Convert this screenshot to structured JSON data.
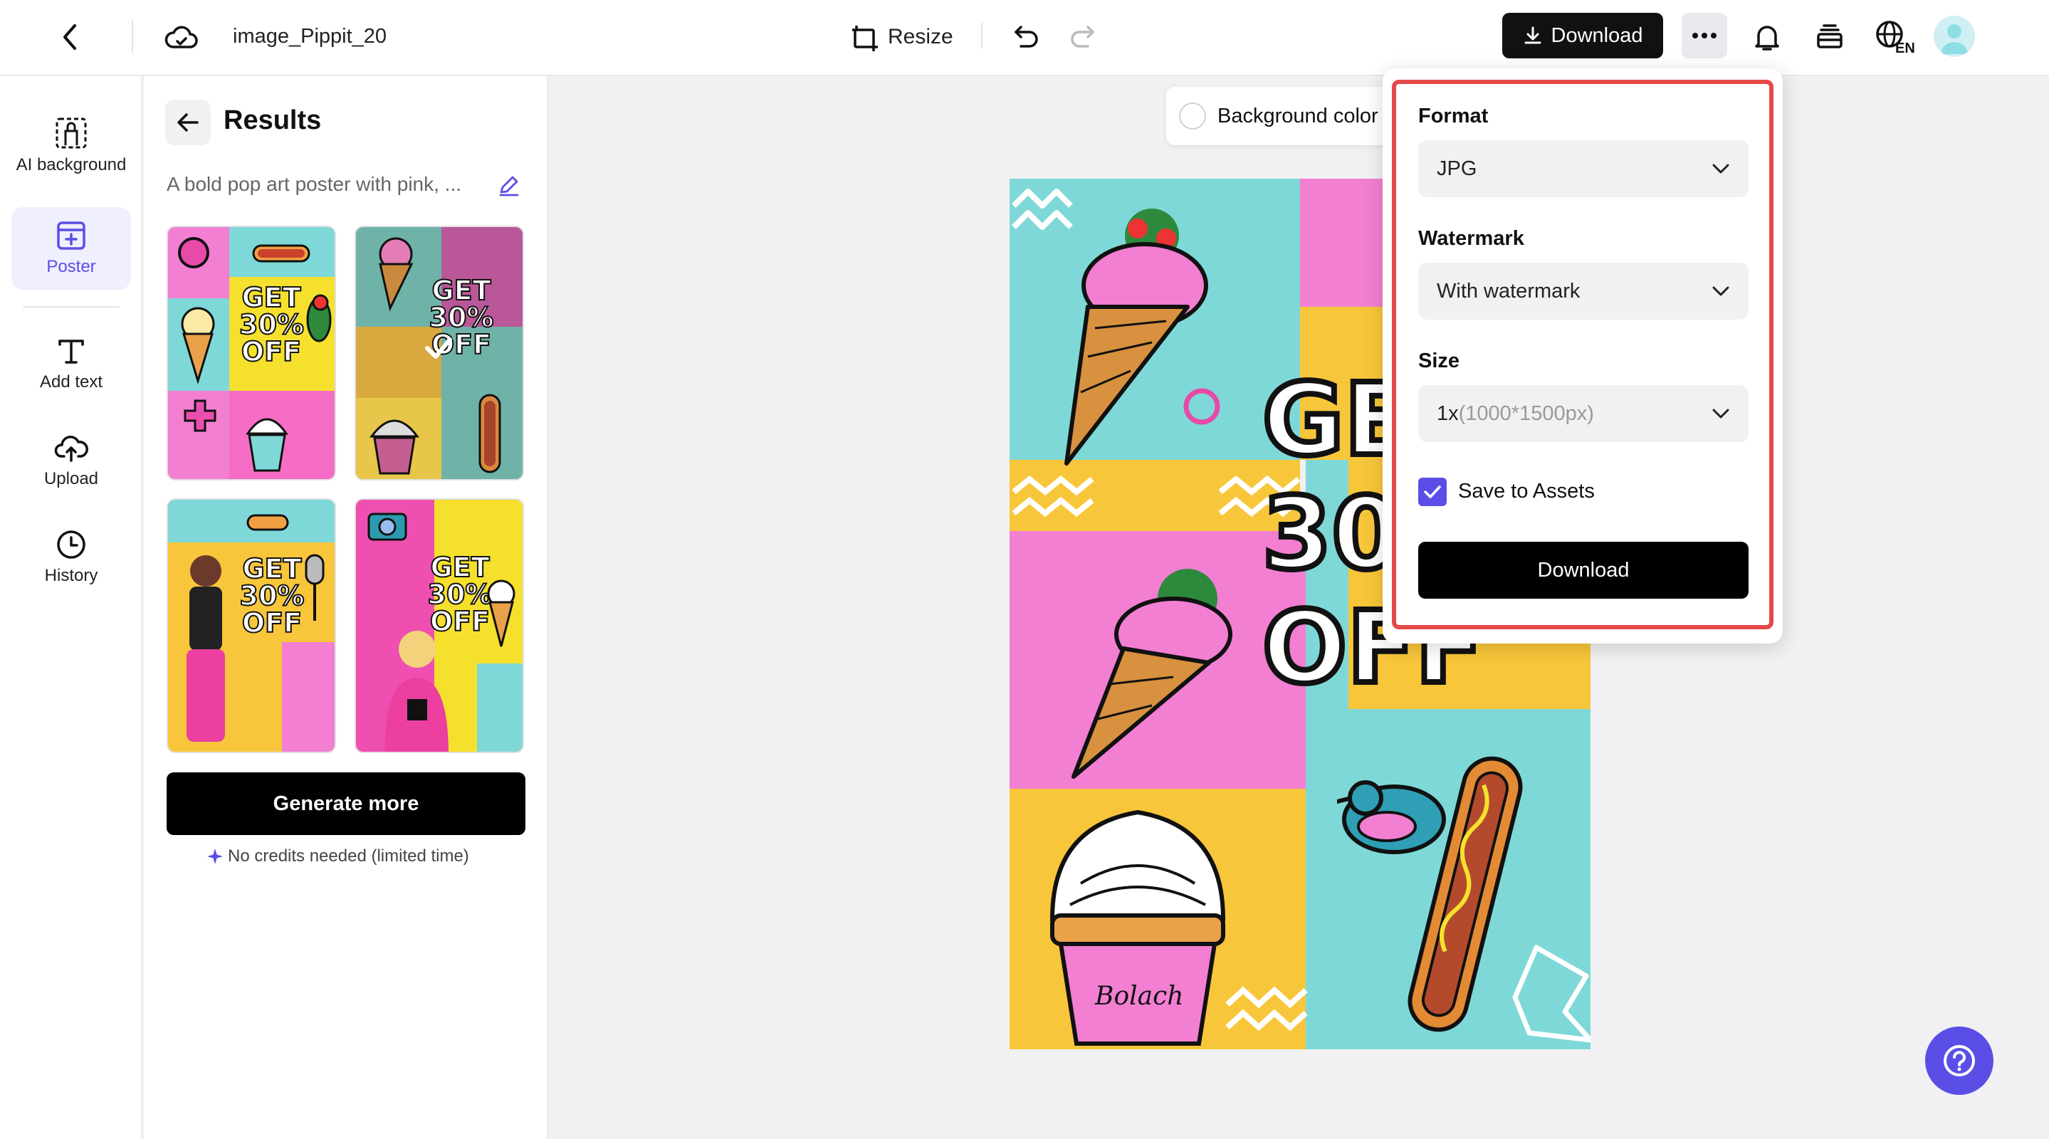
{
  "header": {
    "project_name": "image_Pippit_20",
    "resize_label": "Resize",
    "download_label": "Download",
    "language_code": "EN"
  },
  "rail": {
    "items": [
      {
        "label": "AI background",
        "icon": "ai-background-icon"
      },
      {
        "label": "Poster",
        "icon": "poster-icon",
        "active": true
      },
      {
        "label": "Add text",
        "icon": "text-icon"
      },
      {
        "label": "Upload",
        "icon": "upload-cloud-icon"
      },
      {
        "label": "History",
        "icon": "clock-icon"
      }
    ]
  },
  "results": {
    "title": "Results",
    "prompt": "A bold pop art poster with pink, ...",
    "thumb_text": [
      "GET",
      "30%",
      "OFF"
    ],
    "generate_more_label": "Generate more",
    "credits_note": "No credits needed (limited time)"
  },
  "canvas": {
    "background_color_label": "Background color",
    "poster_text": [
      "GE",
      "30%",
      "OFF"
    ],
    "poster_sign": "Bolach"
  },
  "download_panel": {
    "format_label": "Format",
    "format_value": "JPG",
    "watermark_label": "Watermark",
    "watermark_value": "With watermark",
    "size_label": "Size",
    "size_value": "1x",
    "size_detail": "(1000*1500px)",
    "save_to_assets_label": "Save to Assets",
    "save_to_assets_checked": true,
    "download_button": "Download"
  },
  "colors": {
    "accent": "#5b4ee6",
    "highlight": "#e54848",
    "poster_cyan": "#7fd8d8",
    "poster_yellow": "#f8c63a",
    "poster_pink": "#f27fd2"
  }
}
